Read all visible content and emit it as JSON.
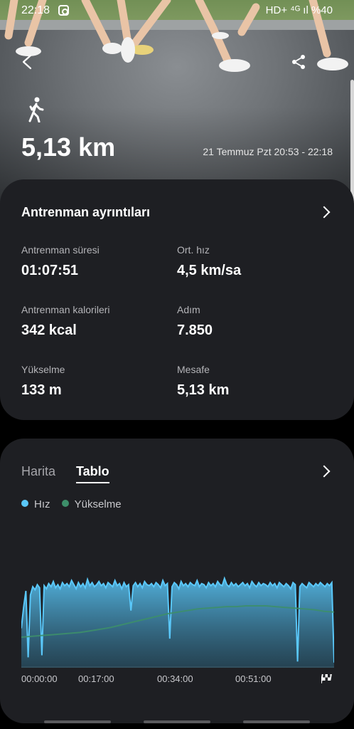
{
  "status_bar": {
    "time": "22:18",
    "right": "HD+ ⁴ᴳ ıl %40"
  },
  "header": {
    "activity_icon": "walking-person-icon",
    "distance": "5,13 km",
    "datetime": "21 Temmuz Pzt 20:53 - 22:18"
  },
  "details": {
    "title": "Antrenman ayrıntıları",
    "stats": [
      {
        "label": "Antrenman süresi",
        "value": "01:07:51"
      },
      {
        "label": "Ort. hız",
        "value": "4,5 km/sa"
      },
      {
        "label": "Antrenman kalorileri",
        "value": "342 kcal"
      },
      {
        "label": "Adım",
        "value": "7.850"
      },
      {
        "label": "Yükselme",
        "value": "133 m"
      },
      {
        "label": "Mesafe",
        "value": "5,13 km"
      }
    ]
  },
  "chart_card": {
    "tabs": [
      {
        "label": "Harita",
        "active": false
      },
      {
        "label": "Tablo",
        "active": true
      }
    ],
    "legend": [
      {
        "label": "Hız",
        "color": "#5ac8fa"
      },
      {
        "label": "Yükselme",
        "color": "#3d8f6a"
      }
    ]
  },
  "chart_data": {
    "type": "area",
    "x_ticks": [
      "00:00:00",
      "00:17:00",
      "00:34:00",
      "00:51:00"
    ],
    "series": [
      {
        "name": "Hız",
        "color": "#5ac8fa",
        "values": [
          0.38,
          0.58,
          0.74,
          0.1,
          0.7,
          0.78,
          0.75,
          0.8,
          0.77,
          0.12,
          0.79,
          0.76,
          0.81,
          0.78,
          0.83,
          0.77,
          0.8,
          0.76,
          0.82,
          0.79,
          0.81,
          0.78,
          0.84,
          0.8,
          0.76,
          0.82,
          0.78,
          0.81,
          0.77,
          0.85,
          0.79,
          0.82,
          0.78,
          0.8,
          0.83,
          0.79,
          0.81,
          0.77,
          0.82,
          0.8,
          0.78,
          0.84,
          0.79,
          0.81,
          0.76,
          0.82,
          0.78,
          0.8,
          0.55,
          0.79,
          0.82,
          0.78,
          0.81,
          0.77,
          0.83,
          0.8,
          0.79,
          0.81,
          0.78,
          0.82,
          0.8,
          0.77,
          0.84,
          0.79,
          0.81,
          0.28,
          0.78,
          0.82,
          0.8,
          0.76,
          0.83,
          0.79,
          0.81,
          0.78,
          0.82,
          0.8,
          0.79,
          0.84,
          0.78,
          0.81,
          0.8,
          0.77,
          0.82,
          0.79,
          0.81,
          0.78,
          0.83,
          0.8,
          0.79,
          0.86,
          0.8,
          0.78,
          0.82,
          0.79,
          0.81,
          0.78,
          0.8,
          0.82,
          0.79,
          0.81,
          0.77,
          0.83,
          0.8,
          0.78,
          0.82,
          0.79,
          0.81,
          0.8,
          0.78,
          0.82,
          0.79,
          0.81,
          0.77,
          0.82,
          0.8,
          0.78,
          0.81,
          0.79,
          0.76,
          0.82,
          0.8,
          0.06,
          0.78,
          0.81,
          0.79,
          0.77,
          0.82,
          0.8,
          0.78,
          0.81,
          0.79,
          0.82,
          0.8,
          0.78,
          0.81,
          0.79,
          0.82,
          0.05
        ]
      },
      {
        "name": "Yükselme",
        "color": "#3d8f6a",
        "values": [
          0.3,
          0.31,
          0.32,
          0.33,
          0.34,
          0.35,
          0.36,
          0.38,
          0.4,
          0.42,
          0.45,
          0.48,
          0.51,
          0.54,
          0.57,
          0.6,
          0.62,
          0.64,
          0.66,
          0.67,
          0.68,
          0.69,
          0.69,
          0.7,
          0.7,
          0.7,
          0.69,
          0.68,
          0.67,
          0.66,
          0.65,
          0.63,
          0.62
        ]
      }
    ],
    "ylim": [
      0,
      1
    ]
  },
  "scroll_to_top_icon": "checkered-flag-icon"
}
